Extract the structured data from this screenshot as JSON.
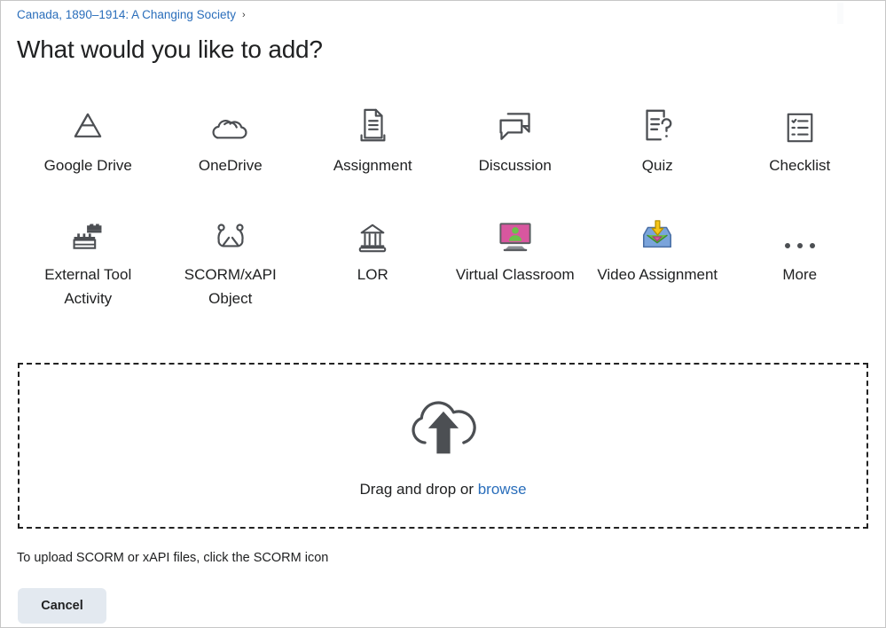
{
  "breadcrumb": {
    "label": "Canada, 1890–1914: A Changing Society",
    "separator": "›",
    "link_color": "#2a6ebb"
  },
  "page_title": "What would you like to add?",
  "tools": [
    {
      "label": "Google Drive",
      "icon": "google-drive-icon"
    },
    {
      "label": "OneDrive",
      "icon": "onedrive-cloud-icon"
    },
    {
      "label": "Assignment",
      "icon": "assignment-document-icon"
    },
    {
      "label": "Discussion",
      "icon": "discussion-speech-bubbles-icon"
    },
    {
      "label": "Quiz",
      "icon": "quiz-question-document-icon"
    },
    {
      "label": "Checklist",
      "icon": "checklist-icon"
    },
    {
      "label": "External Tool Activity",
      "icon": "external-tool-lego-icon"
    },
    {
      "label": "SCORM/xAPI Object",
      "icon": "scorm-xapi-package-icon"
    },
    {
      "label": "LOR",
      "icon": "lor-bank-building-icon"
    },
    {
      "label": "Virtual Classroom",
      "icon": "virtual-classroom-monitor-icon"
    },
    {
      "label": "Video Assignment",
      "icon": "video-assignment-inbox-icon"
    },
    {
      "label": "More",
      "icon": "more-ellipsis-icon"
    }
  ],
  "dropzone": {
    "icon": "cloud-upload-icon",
    "text_prefix": "Drag and drop or ",
    "browse_label": "browse"
  },
  "hint": "To upload SCORM or xAPI files, click the SCORM icon",
  "cancel_label": "Cancel",
  "colors": {
    "link": "#2a6ebb",
    "icon_stroke": "#4c4f53",
    "cancel_bg": "#e3e9f0",
    "dash_border": "#222222",
    "virtual_classroom_screen": "#d8579f",
    "virtual_classroom_person": "#6cc04a",
    "video_assignment_tray": "#7aa4db",
    "video_assignment_arrow": "#f5c518"
  }
}
